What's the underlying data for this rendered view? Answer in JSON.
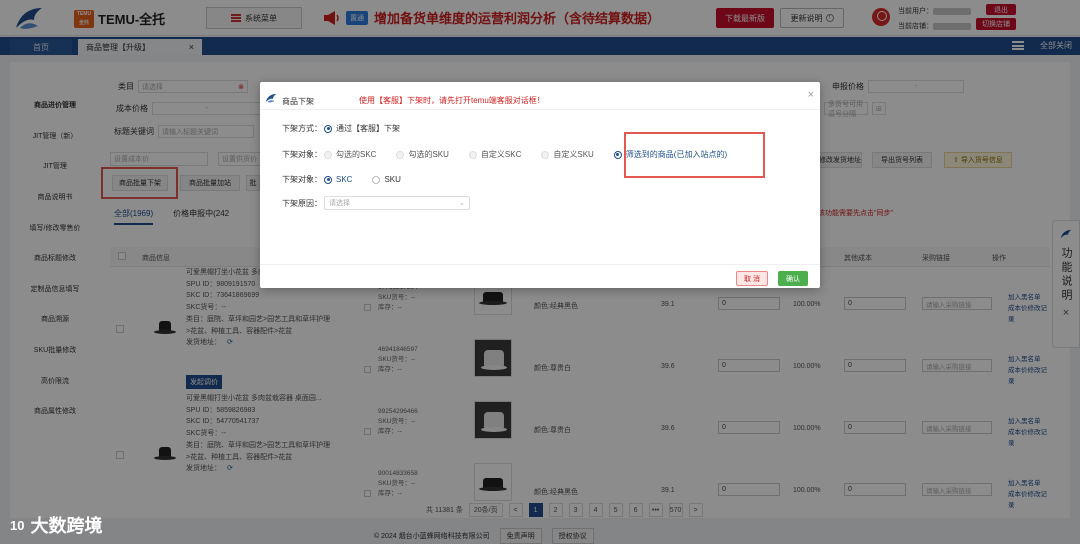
{
  "header": {
    "brand_icon_text": "TEMU\n全托",
    "brand_name": "TEMU-全托",
    "system_menu": "系统菜单",
    "announce_tag": "置通",
    "announce_text": "增加备货单维度的运营利润分析（含待结算数据）",
    "download_btn": "下载最新版",
    "update_btn": "更新说明",
    "current_user_label": "当前用户：",
    "current_store_label": "当前店铺：",
    "logout_btn": "退出",
    "switch_store_btn": "切换店铺"
  },
  "tabs": {
    "home": "首页",
    "goods": "商品管理【升级】",
    "close": "×",
    "fullscreen": "全部关闭"
  },
  "sidebar": {
    "items": [
      {
        "label": "商品进价管理",
        "active": true
      },
      {
        "label": "JIT管理（新）"
      },
      {
        "label": "JIT管理"
      },
      {
        "label": "商品说明书"
      },
      {
        "label": "填写/修改零售价"
      },
      {
        "label": "商品标题修改"
      },
      {
        "label": "定制品信息填写"
      },
      {
        "label": "商品溯源"
      },
      {
        "label": "SKU批量修改"
      },
      {
        "label": "高价限流"
      },
      {
        "label": "商品属性修改"
      }
    ]
  },
  "filters": {
    "category_label": "类目",
    "category_placeholder": "请选择",
    "cost_label": "成本价格",
    "cost_sep": "-",
    "title_kw_label": "标题关键词",
    "title_kw_placeholder": "请输入标题关键词",
    "supply_price_label": "申报价格",
    "supply_sep": "-",
    "multi_code_placeholder": "多货号可用逗号分隔",
    "cost_placeholder": "设置成本价",
    "supply_placeholder": "设置供货价",
    "batch_down_btn": "商品批量下架",
    "batch_add_btn": "商品批量加站",
    "batch_third_btn": "批",
    "ship_addr_btn": "修改发货地址",
    "export_btn": "导出货号列表",
    "import_btn": "导入货号信息"
  },
  "subtabs": {
    "all": "全部(1969)",
    "declaring": "价格申报中(242",
    "sync_tip": "该功能需要先点击\"同步\""
  },
  "table": {
    "headers": {
      "product_info": "商品信息",
      "other_cost": "其他成本",
      "purchase_link": "采购链接",
      "ops": "操作"
    },
    "rows": [
      {
        "info_lines": [
          "可爱黑帽打坐小花盆 多肉盆栽容器",
          "SPU ID：9809191570",
          "SKC ID：73641869699",
          "SKC货号：--",
          "类目：庭院、草坪和园艺>园艺工具和草坪护理",
          ">花盆、种植工具、容器配件>花盆",
          "发货地址："
        ],
        "adjust_btn": "发起调价",
        "skus": [
          {
            "sku_id": "67766217294",
            "sku_code": "SKU货号：--",
            "stock": "库存：--",
            "color": "颜色:经典黑色",
            "price": "39.1",
            "cost": "0",
            "pct": "100.00%",
            "other": "0",
            "link": "请输入采购链接",
            "op1": "加入黑名单",
            "op2": "成本价修改记录",
            "thumb": "dark"
          },
          {
            "sku_id": "46941846597",
            "sku_code": "SKU货号：--",
            "stock": "库存：--",
            "color": "颜色:尊贵白",
            "price": "39.6",
            "cost": "0",
            "pct": "100.00%",
            "other": "0",
            "link": "请输入采购链接",
            "op1": "加入黑名单",
            "op2": "成本价修改记录",
            "thumb": "white"
          }
        ]
      },
      {
        "info_lines": [
          "可爱黑帽打坐小花盆 多肉盆栽容器 桌面园...",
          "SPU ID：5859826983",
          "SKC ID：54770541737",
          "SKC货号：--",
          "类目：庭院、草坪和园艺>园艺工具和草坪护理",
          ">花盆、种植工具、容器配件>花盆",
          "发货地址："
        ],
        "skus": [
          {
            "sku_id": "99254296466",
            "sku_code": "SKU货号：--",
            "stock": "库存：--",
            "color": "颜色:尊贵白",
            "price": "39.6",
            "cost": "0",
            "pct": "100.00%",
            "other": "0",
            "link": "请输入采购链接",
            "op1": "加入黑名单",
            "op2": "成本价修改记录",
            "thumb": "white"
          },
          {
            "sku_id": "90014833658",
            "sku_code": "SKU货号：--",
            "stock": "库存：--",
            "color": "颜色:经典黑色",
            "price": "39.1",
            "cost": "0",
            "pct": "100.00%",
            "other": "0",
            "link": "请输入采购链接",
            "op1": "加入黑名单",
            "op2": "成本价修改记录",
            "thumb": "dark"
          }
        ]
      }
    ]
  },
  "pagination": {
    "total": "共 11381 条",
    "page_size": "20条/页",
    "pages": [
      "1",
      "2",
      "3",
      "4",
      "5",
      "6",
      "•••",
      "570"
    ],
    "prev": "<",
    "next": ">"
  },
  "footer": {
    "copyright": "© 2024 烟台小蓝蜂网络科技有限公司",
    "disclaimer": "免责声明",
    "license": "授权协议"
  },
  "watermark": {
    "logo": "10",
    "text": "大数跨境"
  },
  "help_tab": {
    "text": "功能说明",
    "close": "×"
  },
  "modal": {
    "title": "商品下架",
    "warning": "使用【客服】下架时，请先打开temu端客服对话框！",
    "close": "×",
    "method_label": "下架方式：",
    "method_option": "通过【客服】下架",
    "target_label": "下架对象：",
    "target_options": [
      "勾选的SKC",
      "勾选的SKU",
      "自定义SKC",
      "自定义SKU",
      "筛选到的商品(已加入站点的)"
    ],
    "target2_label": "下架对象：",
    "target2_options": [
      "SKC",
      "SKU"
    ],
    "reason_label": "下架原因：",
    "reason_placeholder": "请选择",
    "cancel_btn": "取 消",
    "ok_btn": "确认"
  }
}
